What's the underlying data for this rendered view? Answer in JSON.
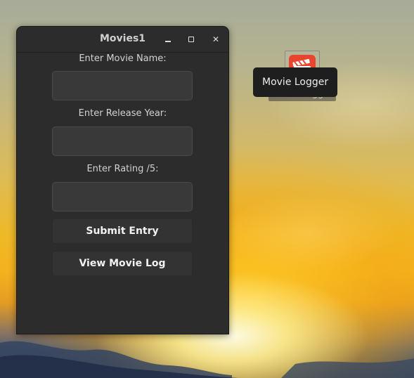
{
  "window": {
    "title": "Movies1"
  },
  "form": {
    "movie_name_label": "Enter Movie Name:",
    "movie_name_value": "",
    "release_year_label": "Enter Release Year:",
    "release_year_value": "",
    "rating_label": "Enter Rating /5:",
    "rating_value": "",
    "submit_label": "Submit Entry",
    "view_log_label": "View Movie Log"
  },
  "desktop": {
    "icon_name": "clapperboard-app-icon",
    "icon_label": "Movie Logger",
    "tooltip_text": "Movie Logger"
  },
  "colors": {
    "window_bg": "#2c2c2c",
    "input_bg": "#393939",
    "icon_red": "#e8442f"
  }
}
